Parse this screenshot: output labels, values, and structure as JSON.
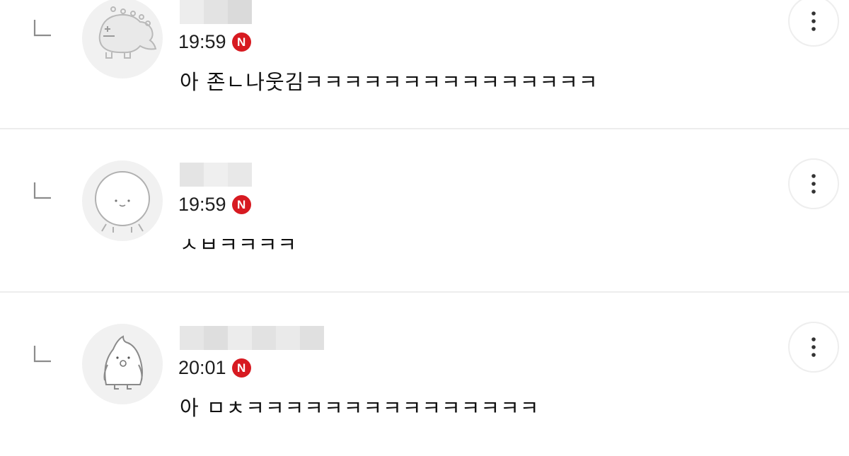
{
  "replies": [
    {
      "time": "19:59",
      "badge": "N",
      "text": "아 존ㄴ나웃김ㅋㅋㅋㅋㅋㅋㅋㅋㅋㅋㅋㅋㅋㅋㅋ",
      "avatar": "dinosaur-avatar",
      "author_name_redacted": true
    },
    {
      "time": "19:59",
      "badge": "N",
      "text": "ㅅㅂㅋㅋㅋㅋ",
      "avatar": "round-face-avatar",
      "author_name_redacted": true
    },
    {
      "time": "20:01",
      "badge": "N",
      "text": "아 ㅁㅊㅋㅋㅋㅋㅋㅋㅋㅋㅋㅋㅋㅋㅋㅋㅋ",
      "avatar": "bird-avatar",
      "author_name_redacted": true
    }
  ],
  "icons": {
    "reply": "reply-arrow-icon",
    "more": "more-vertical-icon"
  },
  "colors": {
    "badge": "#d71a21",
    "divider": "#ededed",
    "text": "#111111"
  }
}
